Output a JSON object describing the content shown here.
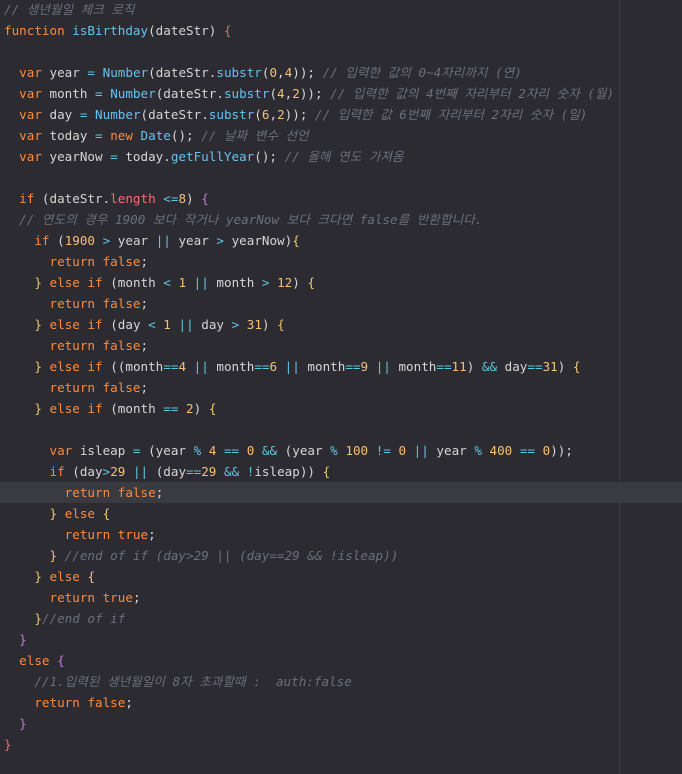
{
  "editor": {
    "lines": [
      [
        {
          "t": "// 생년월일 체크 로직",
          "c": "cm"
        }
      ],
      [
        {
          "t": "function",
          "c": "kw"
        },
        {
          "t": " ",
          "c": "plain"
        },
        {
          "t": "isBirthday",
          "c": "fn"
        },
        {
          "t": "(dateStr) ",
          "c": "plain"
        },
        {
          "t": "{",
          "c": "brace3"
        }
      ],
      [],
      [
        {
          "t": "  ",
          "c": "plain"
        },
        {
          "t": "var",
          "c": "kw"
        },
        {
          "t": " year ",
          "c": "plain"
        },
        {
          "t": "=",
          "c": "op"
        },
        {
          "t": " ",
          "c": "plain"
        },
        {
          "t": "Number",
          "c": "fn"
        },
        {
          "t": "(dateStr.",
          "c": "plain"
        },
        {
          "t": "substr",
          "c": "fn"
        },
        {
          "t": "(",
          "c": "plain"
        },
        {
          "t": "0",
          "c": "num"
        },
        {
          "t": ",",
          "c": "plain"
        },
        {
          "t": "4",
          "c": "num"
        },
        {
          "t": ")); ",
          "c": "plain"
        },
        {
          "t": "// 입력한 값의 0~4자리까지 (연)",
          "c": "cm"
        }
      ],
      [
        {
          "t": "  ",
          "c": "plain"
        },
        {
          "t": "var",
          "c": "kw"
        },
        {
          "t": " month ",
          "c": "plain"
        },
        {
          "t": "=",
          "c": "op"
        },
        {
          "t": " ",
          "c": "plain"
        },
        {
          "t": "Number",
          "c": "fn"
        },
        {
          "t": "(dateStr.",
          "c": "plain"
        },
        {
          "t": "substr",
          "c": "fn"
        },
        {
          "t": "(",
          "c": "plain"
        },
        {
          "t": "4",
          "c": "num"
        },
        {
          "t": ",",
          "c": "plain"
        },
        {
          "t": "2",
          "c": "num"
        },
        {
          "t": ")); ",
          "c": "plain"
        },
        {
          "t": "// 입력한 값의 4번째 자리부터 2자리 숫자 (월)",
          "c": "cm"
        }
      ],
      [
        {
          "t": "  ",
          "c": "plain"
        },
        {
          "t": "var",
          "c": "kw"
        },
        {
          "t": " day ",
          "c": "plain"
        },
        {
          "t": "=",
          "c": "op"
        },
        {
          "t": " ",
          "c": "plain"
        },
        {
          "t": "Number",
          "c": "fn"
        },
        {
          "t": "(dateStr.",
          "c": "plain"
        },
        {
          "t": "substr",
          "c": "fn"
        },
        {
          "t": "(",
          "c": "plain"
        },
        {
          "t": "6",
          "c": "num"
        },
        {
          "t": ",",
          "c": "plain"
        },
        {
          "t": "2",
          "c": "num"
        },
        {
          "t": ")); ",
          "c": "plain"
        },
        {
          "t": "// 입력한 값 6번째 자리부터 2자리 숫자 (일)",
          "c": "cm"
        }
      ],
      [
        {
          "t": "  ",
          "c": "plain"
        },
        {
          "t": "var",
          "c": "kw"
        },
        {
          "t": " today ",
          "c": "plain"
        },
        {
          "t": "=",
          "c": "op"
        },
        {
          "t": " ",
          "c": "plain"
        },
        {
          "t": "new",
          "c": "kw"
        },
        {
          "t": " ",
          "c": "plain"
        },
        {
          "t": "Date",
          "c": "fn"
        },
        {
          "t": "(); ",
          "c": "plain"
        },
        {
          "t": "// 날짜 변수 선언",
          "c": "cm"
        }
      ],
      [
        {
          "t": "  ",
          "c": "plain"
        },
        {
          "t": "var",
          "c": "kw"
        },
        {
          "t": " yearNow ",
          "c": "plain"
        },
        {
          "t": "=",
          "c": "op"
        },
        {
          "t": " today.",
          "c": "plain"
        },
        {
          "t": "getFullYear",
          "c": "fn"
        },
        {
          "t": "(); ",
          "c": "plain"
        },
        {
          "t": "// 올해 연도 가져옴",
          "c": "cm"
        }
      ],
      [],
      [
        {
          "t": "  ",
          "c": "plain"
        },
        {
          "t": "if",
          "c": "kw"
        },
        {
          "t": " (dateStr.",
          "c": "plain"
        },
        {
          "t": "length",
          "c": "prop"
        },
        {
          "t": " ",
          "c": "plain"
        },
        {
          "t": "<=",
          "c": "op"
        },
        {
          "t": "8",
          "c": "num"
        },
        {
          "t": ") ",
          "c": "plain"
        },
        {
          "t": "{",
          "c": "brace2"
        }
      ],
      [
        {
          "t": "  ",
          "c": "plain"
        },
        {
          "t": "// 연도의 경우 1900 보다 작거나 yearNow 보다 크다면 false를 반환합니다.",
          "c": "cm"
        }
      ],
      [
        {
          "t": "    ",
          "c": "plain"
        },
        {
          "t": "if",
          "c": "kw"
        },
        {
          "t": " (",
          "c": "plain"
        },
        {
          "t": "1900",
          "c": "num"
        },
        {
          "t": " ",
          "c": "plain"
        },
        {
          "t": ">",
          "c": "op"
        },
        {
          "t": " year ",
          "c": "plain"
        },
        {
          "t": "||",
          "c": "op"
        },
        {
          "t": " year ",
          "c": "plain"
        },
        {
          "t": ">",
          "c": "op"
        },
        {
          "t": " yearNow)",
          "c": "plain"
        },
        {
          "t": "{",
          "c": "brace"
        }
      ],
      [
        {
          "t": "      ",
          "c": "plain"
        },
        {
          "t": "return",
          "c": "kw"
        },
        {
          "t": " ",
          "c": "plain"
        },
        {
          "t": "false",
          "c": "kw"
        },
        {
          "t": ";",
          "c": "plain"
        }
      ],
      [
        {
          "t": "    ",
          "c": "plain"
        },
        {
          "t": "}",
          "c": "brace"
        },
        {
          "t": " ",
          "c": "plain"
        },
        {
          "t": "else if",
          "c": "kw"
        },
        {
          "t": " (month ",
          "c": "plain"
        },
        {
          "t": "<",
          "c": "op"
        },
        {
          "t": " ",
          "c": "plain"
        },
        {
          "t": "1",
          "c": "num"
        },
        {
          "t": " ",
          "c": "plain"
        },
        {
          "t": "||",
          "c": "op"
        },
        {
          "t": " month ",
          "c": "plain"
        },
        {
          "t": ">",
          "c": "op"
        },
        {
          "t": " ",
          "c": "plain"
        },
        {
          "t": "12",
          "c": "num"
        },
        {
          "t": ") ",
          "c": "plain"
        },
        {
          "t": "{",
          "c": "brace"
        }
      ],
      [
        {
          "t": "      ",
          "c": "plain"
        },
        {
          "t": "return",
          "c": "kw"
        },
        {
          "t": " ",
          "c": "plain"
        },
        {
          "t": "false",
          "c": "kw"
        },
        {
          "t": ";",
          "c": "plain"
        }
      ],
      [
        {
          "t": "    ",
          "c": "plain"
        },
        {
          "t": "}",
          "c": "brace"
        },
        {
          "t": " ",
          "c": "plain"
        },
        {
          "t": "else if",
          "c": "kw"
        },
        {
          "t": " (day ",
          "c": "plain"
        },
        {
          "t": "<",
          "c": "op"
        },
        {
          "t": " ",
          "c": "plain"
        },
        {
          "t": "1",
          "c": "num"
        },
        {
          "t": " ",
          "c": "plain"
        },
        {
          "t": "||",
          "c": "op"
        },
        {
          "t": " day ",
          "c": "plain"
        },
        {
          "t": ">",
          "c": "op"
        },
        {
          "t": " ",
          "c": "plain"
        },
        {
          "t": "31",
          "c": "num"
        },
        {
          "t": ") ",
          "c": "plain"
        },
        {
          "t": "{",
          "c": "brace"
        }
      ],
      [
        {
          "t": "      ",
          "c": "plain"
        },
        {
          "t": "return",
          "c": "kw"
        },
        {
          "t": " ",
          "c": "plain"
        },
        {
          "t": "false",
          "c": "kw"
        },
        {
          "t": ";",
          "c": "plain"
        }
      ],
      [
        {
          "t": "    ",
          "c": "plain"
        },
        {
          "t": "}",
          "c": "brace"
        },
        {
          "t": " ",
          "c": "plain"
        },
        {
          "t": "else if",
          "c": "kw"
        },
        {
          "t": " ((month",
          "c": "plain"
        },
        {
          "t": "==",
          "c": "op"
        },
        {
          "t": "4",
          "c": "num"
        },
        {
          "t": " ",
          "c": "plain"
        },
        {
          "t": "||",
          "c": "op"
        },
        {
          "t": " month",
          "c": "plain"
        },
        {
          "t": "==",
          "c": "op"
        },
        {
          "t": "6",
          "c": "num"
        },
        {
          "t": " ",
          "c": "plain"
        },
        {
          "t": "||",
          "c": "op"
        },
        {
          "t": " month",
          "c": "plain"
        },
        {
          "t": "==",
          "c": "op"
        },
        {
          "t": "9",
          "c": "num"
        },
        {
          "t": " ",
          "c": "plain"
        },
        {
          "t": "||",
          "c": "op"
        },
        {
          "t": " month",
          "c": "plain"
        },
        {
          "t": "==",
          "c": "op"
        },
        {
          "t": "11",
          "c": "num"
        },
        {
          "t": ") ",
          "c": "plain"
        },
        {
          "t": "&&",
          "c": "op"
        },
        {
          "t": " day",
          "c": "plain"
        },
        {
          "t": "==",
          "c": "op"
        },
        {
          "t": "31",
          "c": "num"
        },
        {
          "t": ") ",
          "c": "plain"
        },
        {
          "t": "{",
          "c": "brace"
        }
      ],
      [
        {
          "t": "      ",
          "c": "plain"
        },
        {
          "t": "return",
          "c": "kw"
        },
        {
          "t": " ",
          "c": "plain"
        },
        {
          "t": "false",
          "c": "kw"
        },
        {
          "t": ";",
          "c": "plain"
        }
      ],
      [
        {
          "t": "    ",
          "c": "plain"
        },
        {
          "t": "}",
          "c": "brace"
        },
        {
          "t": " ",
          "c": "plain"
        },
        {
          "t": "else if",
          "c": "kw"
        },
        {
          "t": " (month ",
          "c": "plain"
        },
        {
          "t": "==",
          "c": "op"
        },
        {
          "t": " ",
          "c": "plain"
        },
        {
          "t": "2",
          "c": "num"
        },
        {
          "t": ") ",
          "c": "plain"
        },
        {
          "t": "{",
          "c": "brace"
        }
      ],
      [],
      [
        {
          "t": "      ",
          "c": "plain"
        },
        {
          "t": "var",
          "c": "kw"
        },
        {
          "t": " isleap ",
          "c": "plain"
        },
        {
          "t": "=",
          "c": "op"
        },
        {
          "t": " (year ",
          "c": "plain"
        },
        {
          "t": "%",
          "c": "op"
        },
        {
          "t": " ",
          "c": "plain"
        },
        {
          "t": "4",
          "c": "num"
        },
        {
          "t": " ",
          "c": "plain"
        },
        {
          "t": "==",
          "c": "op"
        },
        {
          "t": " ",
          "c": "plain"
        },
        {
          "t": "0",
          "c": "num"
        },
        {
          "t": " ",
          "c": "plain"
        },
        {
          "t": "&&",
          "c": "op"
        },
        {
          "t": " (year ",
          "c": "plain"
        },
        {
          "t": "%",
          "c": "op"
        },
        {
          "t": " ",
          "c": "plain"
        },
        {
          "t": "100",
          "c": "num"
        },
        {
          "t": " ",
          "c": "plain"
        },
        {
          "t": "!=",
          "c": "op"
        },
        {
          "t": " ",
          "c": "plain"
        },
        {
          "t": "0",
          "c": "num"
        },
        {
          "t": " ",
          "c": "plain"
        },
        {
          "t": "||",
          "c": "op"
        },
        {
          "t": " year ",
          "c": "plain"
        },
        {
          "t": "%",
          "c": "op"
        },
        {
          "t": " ",
          "c": "plain"
        },
        {
          "t": "400",
          "c": "num"
        },
        {
          "t": " ",
          "c": "plain"
        },
        {
          "t": "==",
          "c": "op"
        },
        {
          "t": " ",
          "c": "plain"
        },
        {
          "t": "0",
          "c": "num"
        },
        {
          "t": "));",
          "c": "plain"
        }
      ],
      [
        {
          "t": "      ",
          "c": "plain"
        },
        {
          "t": "if",
          "c": "kw"
        },
        {
          "t": " (day",
          "c": "plain"
        },
        {
          "t": ">",
          "c": "op"
        },
        {
          "t": "29",
          "c": "num"
        },
        {
          "t": " ",
          "c": "plain"
        },
        {
          "t": "||",
          "c": "op"
        },
        {
          "t": " (day",
          "c": "plain"
        },
        {
          "t": "==",
          "c": "op"
        },
        {
          "t": "29",
          "c": "num"
        },
        {
          "t": " ",
          "c": "plain"
        },
        {
          "t": "&&",
          "c": "op"
        },
        {
          "t": " ",
          "c": "plain"
        },
        {
          "t": "!",
          "c": "op"
        },
        {
          "t": "isleap)) ",
          "c": "plain"
        },
        {
          "t": "{",
          "c": "brace"
        }
      ],
      [
        {
          "t": "        ",
          "c": "plain"
        },
        {
          "t": "return",
          "c": "kw"
        },
        {
          "t": " ",
          "c": "plain"
        },
        {
          "t": "false",
          "c": "kw"
        },
        {
          "t": ";",
          "c": "plain"
        }
      ],
      [
        {
          "t": "      ",
          "c": "plain"
        },
        {
          "t": "}",
          "c": "brace"
        },
        {
          "t": " ",
          "c": "plain"
        },
        {
          "t": "else",
          "c": "kw"
        },
        {
          "t": " ",
          "c": "plain"
        },
        {
          "t": "{",
          "c": "brace"
        }
      ],
      [
        {
          "t": "        ",
          "c": "plain"
        },
        {
          "t": "return",
          "c": "kw"
        },
        {
          "t": " ",
          "c": "plain"
        },
        {
          "t": "true",
          "c": "kw"
        },
        {
          "t": ";",
          "c": "plain"
        }
      ],
      [
        {
          "t": "      ",
          "c": "plain"
        },
        {
          "t": "}",
          "c": "brace"
        },
        {
          "t": " ",
          "c": "plain"
        },
        {
          "t": "//end of if (day>29 || (day==29 && !isleap))",
          "c": "cm"
        }
      ],
      [
        {
          "t": "    ",
          "c": "plain"
        },
        {
          "t": "}",
          "c": "brace"
        },
        {
          "t": " ",
          "c": "plain"
        },
        {
          "t": "else",
          "c": "kw"
        },
        {
          "t": " ",
          "c": "plain"
        },
        {
          "t": "{",
          "c": "brace"
        }
      ],
      [
        {
          "t": "      ",
          "c": "plain"
        },
        {
          "t": "return",
          "c": "kw"
        },
        {
          "t": " ",
          "c": "plain"
        },
        {
          "t": "true",
          "c": "kw"
        },
        {
          "t": ";",
          "c": "plain"
        }
      ],
      [
        {
          "t": "    ",
          "c": "plain"
        },
        {
          "t": "}",
          "c": "brace"
        },
        {
          "t": "//end of if",
          "c": "cm"
        }
      ],
      [
        {
          "t": "  ",
          "c": "plain"
        },
        {
          "t": "}",
          "c": "brace2"
        }
      ],
      [
        {
          "t": "  ",
          "c": "plain"
        },
        {
          "t": "else",
          "c": "kw"
        },
        {
          "t": " ",
          "c": "plain"
        },
        {
          "t": "{",
          "c": "brace2"
        }
      ],
      [
        {
          "t": "    ",
          "c": "plain"
        },
        {
          "t": "//1.입력된 생년월일이 8자 초과할때 :  auth:false",
          "c": "cm"
        }
      ],
      [
        {
          "t": "    ",
          "c": "plain"
        },
        {
          "t": "return",
          "c": "kw"
        },
        {
          "t": " ",
          "c": "plain"
        },
        {
          "t": "false",
          "c": "kw"
        },
        {
          "t": ";",
          "c": "plain"
        }
      ],
      [
        {
          "t": "  ",
          "c": "plain"
        },
        {
          "t": "}",
          "c": "brace2"
        }
      ],
      [
        {
          "t": "}",
          "c": "brace3"
        }
      ]
    ],
    "current_line": 24
  }
}
